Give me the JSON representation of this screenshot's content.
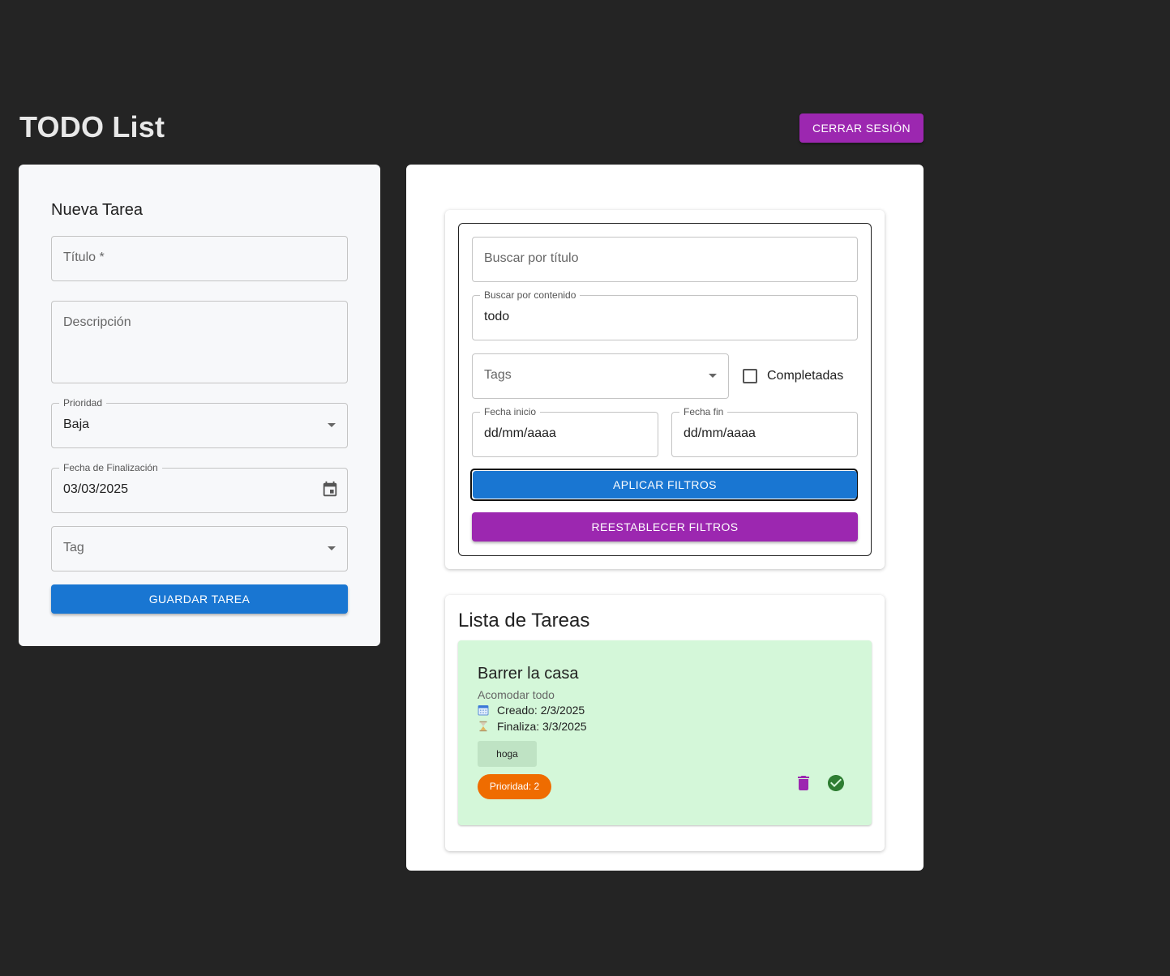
{
  "header": {
    "title": "TODO List",
    "logout_label": "CERRAR SESIÓN"
  },
  "new_task": {
    "title": "Nueva Tarea",
    "titulo_placeholder": "Título *",
    "descripcion_placeholder": "Descripción",
    "prioridad_label": "Prioridad",
    "prioridad_value": "Baja",
    "fecha_label": "Fecha de Finalización",
    "fecha_value": "03/03/2025",
    "tag_placeholder": "Tag",
    "save_label": "GUARDAR TAREA"
  },
  "filters": {
    "title_search_placeholder": "Buscar por título",
    "content_search_label": "Buscar por contenido",
    "content_search_value": "todo",
    "tags_placeholder": "Tags",
    "completed_label": "Completadas",
    "completed_checked": false,
    "start_date_label": "Fecha inicio",
    "start_date_value": "dd/mm/aaaa",
    "end_date_label": "Fecha fin",
    "end_date_value": "dd/mm/aaaa",
    "apply_label": "APLICAR FILTROS",
    "reset_label": "REESTABLECER FILTROS"
  },
  "task_list": {
    "title": "Lista de Tareas",
    "tasks": [
      {
        "title": "Barrer la casa",
        "description": "Acomodar todo",
        "created": "Creado: 2/3/2025",
        "due": "Finaliza: 3/3/2025",
        "tag": "hoga",
        "priority": "Prioridad: 2",
        "background": "#d4f7d9"
      }
    ]
  },
  "colors": {
    "background": "#242424",
    "primary": "#1976d2",
    "secondary": "#9c27b0",
    "priority": "#ef6c00",
    "success": "#2e7d32"
  },
  "icons": {
    "calendar": "calendar-icon",
    "dropdown": "chevron-down-icon",
    "delete": "delete-icon",
    "complete": "check-circle-icon"
  }
}
